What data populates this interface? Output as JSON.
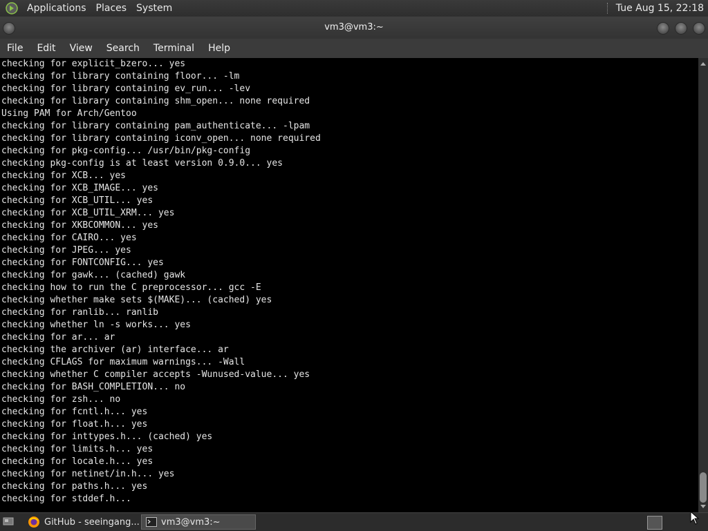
{
  "top_panel": {
    "menus": [
      "Applications",
      "Places",
      "System"
    ],
    "clock": "Tue Aug 15, 22:18"
  },
  "window": {
    "title": "vm3@vm3:~",
    "menu": [
      "File",
      "Edit",
      "View",
      "Search",
      "Terminal",
      "Help"
    ]
  },
  "terminal": {
    "lines": [
      "checking for explicit_bzero... yes",
      "checking for library containing floor... -lm",
      "checking for library containing ev_run... -lev",
      "checking for library containing shm_open... none required",
      "Using PAM for Arch/Gentoo",
      "checking for library containing pam_authenticate... -lpam",
      "checking for library containing iconv_open... none required",
      "checking for pkg-config... /usr/bin/pkg-config",
      "checking pkg-config is at least version 0.9.0... yes",
      "checking for XCB... yes",
      "checking for XCB_IMAGE... yes",
      "checking for XCB_UTIL... yes",
      "checking for XCB_UTIL_XRM... yes",
      "checking for XKBCOMMON... yes",
      "checking for CAIRO... yes",
      "checking for JPEG... yes",
      "checking for FONTCONFIG... yes",
      "checking for gawk... (cached) gawk",
      "checking how to run the C preprocessor... gcc -E",
      "checking whether make sets $(MAKE)... (cached) yes",
      "checking for ranlib... ranlib",
      "checking whether ln -s works... yes",
      "checking for ar... ar",
      "checking the archiver (ar) interface... ar",
      "checking CFLAGS for maximum warnings... -Wall",
      "checking whether C compiler accepts -Wunused-value... yes",
      "checking for BASH_COMPLETION... no",
      "checking for zsh... no",
      "checking for fcntl.h... yes",
      "checking for float.h... yes",
      "checking for inttypes.h... (cached) yes",
      "checking for limits.h... yes",
      "checking for locale.h... yes",
      "checking for netinet/in.h... yes",
      "checking for paths.h... yes",
      "checking for stddef.h..."
    ]
  },
  "taskbar": {
    "tasks": [
      {
        "label": "GitHub - seeingang...",
        "icon": "firefox-icon"
      },
      {
        "label": "vm3@vm3:~",
        "icon": "terminal-icon"
      }
    ]
  },
  "colors": {
    "terminal_bg": "#000000",
    "terminal_fg": "#e6e6e6",
    "panel_bg": "#2e2e2e"
  }
}
